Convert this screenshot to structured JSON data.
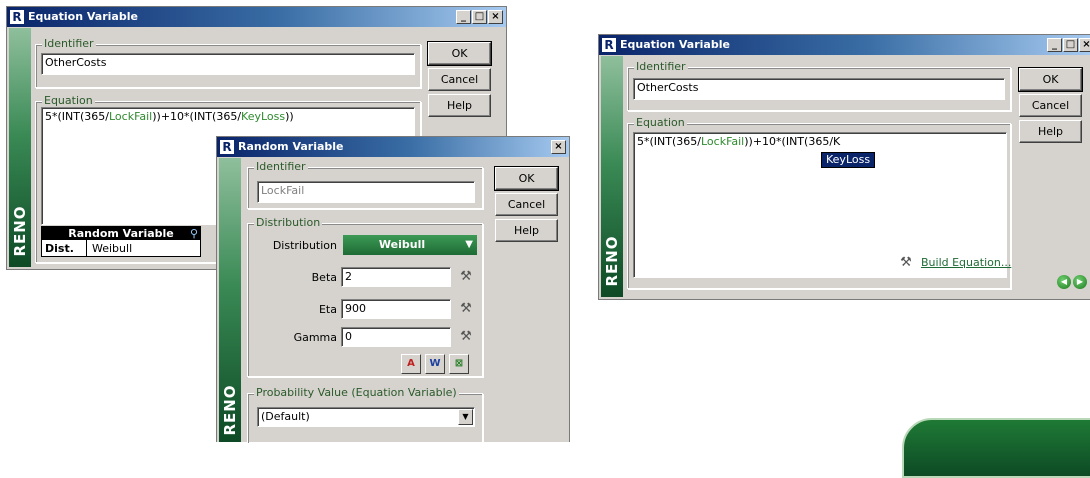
{
  "win1": {
    "title": "Equation Variable",
    "identifier_label": "Identifier",
    "identifier_value": "OtherCosts",
    "equation_label": "Equation",
    "eq": {
      "p1": "5*(INT(365/",
      "v1": "LockFail",
      "p2": "))+10*(INT(365/",
      "v2": "KeyLoss",
      "p3": "))"
    },
    "ok": "OK",
    "cancel": "Cancel",
    "help": "Help",
    "brand": "RENO",
    "rv_title": "Random Variable",
    "rv_dist_label": "Dist.",
    "rv_dist_value": "Weibull"
  },
  "win2": {
    "title": "Random Variable",
    "identifier_label": "Identifier",
    "identifier_value": "LockFail",
    "distribution_group": "Distribution",
    "distribution_label": "Distribution",
    "distribution_value": "Weibull",
    "beta_label": "Beta",
    "beta_value": "2",
    "eta_label": "Eta",
    "eta_value": "900",
    "gamma_label": "Gamma",
    "gamma_value": "0",
    "prob_label": "Probability Value (Equation Variable)",
    "prob_value": "(Default)",
    "ok": "OK",
    "cancel": "Cancel",
    "help": "Help",
    "brand": "RENO",
    "icon_a": "A",
    "icon_w": "W"
  },
  "win3": {
    "title": "Equation Variable",
    "identifier_label": "Identifier",
    "identifier_value": "OtherCosts",
    "equation_label": "Equation",
    "eq": {
      "p1": "5*(INT(365/",
      "v1": "LockFail",
      "p2": "))+10*(INT(365/K"
    },
    "autocomplete": "KeyLoss",
    "build": "Build Equation...",
    "ok": "OK",
    "cancel": "Cancel",
    "help": "Help",
    "brand": "RENO"
  },
  "colors": {
    "titlebar": "#0a246a",
    "brand_green": "#1f6b35",
    "variable_green": "#2e8b2e"
  },
  "icons": [
    "minimize-icon",
    "maximize-icon",
    "close-icon",
    "wrench-icon",
    "magnifier-icon",
    "prev-icon",
    "next-icon",
    "dropdown-arrow-icon"
  ]
}
